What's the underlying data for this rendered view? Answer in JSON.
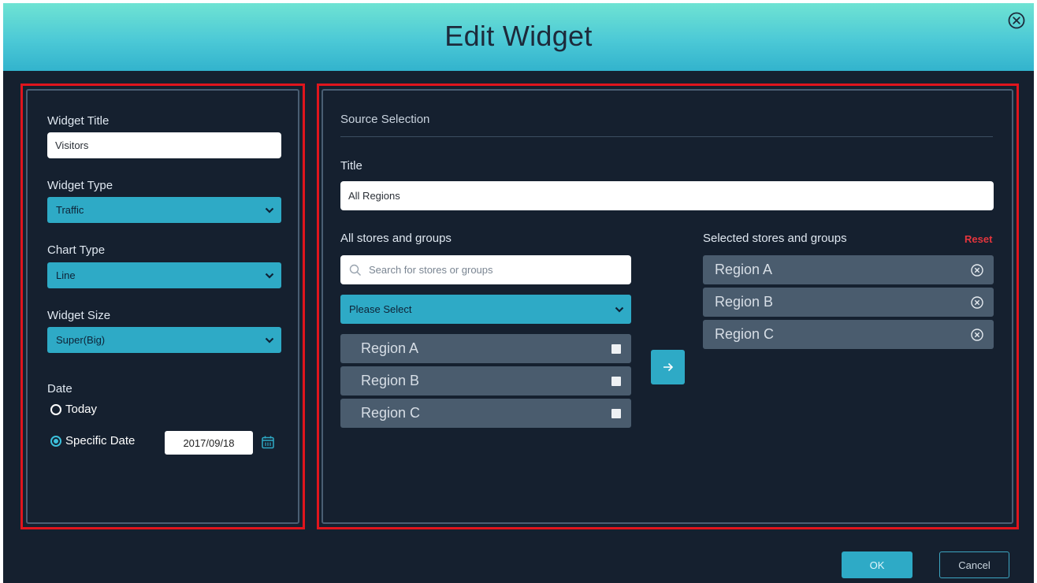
{
  "header": {
    "title": "Edit Widget"
  },
  "left_panel": {
    "widget_title_label": "Widget Title",
    "widget_title_value": "Visitors",
    "widget_type_label": "Widget Type",
    "widget_type_value": "Traffic",
    "chart_type_label": "Chart Type",
    "chart_type_value": "Line",
    "widget_size_label": "Widget Size",
    "widget_size_value": "Super(Big)",
    "date_label": "Date",
    "date_options": [
      {
        "label": "Today",
        "selected": false
      },
      {
        "label": "Specific Date",
        "selected": true
      }
    ],
    "specific_date_value": "2017/09/18"
  },
  "right_panel": {
    "section_title": "Source Selection",
    "title_label": "Title",
    "title_value": "All Regions",
    "all_label": "All stores and groups",
    "search_placeholder": "Search for stores or groups",
    "group_select_value": "Please Select",
    "all_items": [
      {
        "label": "Region A"
      },
      {
        "label": "Region B"
      },
      {
        "label": "Region C"
      }
    ],
    "selected_label": "Selected stores and groups",
    "reset_label": "Reset",
    "selected_items": [
      {
        "label": "Region A"
      },
      {
        "label": "Region B"
      },
      {
        "label": "Region C"
      }
    ]
  },
  "footer": {
    "ok_label": "OK",
    "cancel_label": "Cancel"
  },
  "colors": {
    "accent": "#2eaac6",
    "background": "#15202f",
    "highlight_frame": "#e0151d",
    "reset": "#e4353d"
  },
  "icons": [
    "close-circle-icon",
    "chevron-down-icon",
    "calendar-icon",
    "search-icon",
    "arrow-right-icon",
    "remove-circle-icon"
  ]
}
